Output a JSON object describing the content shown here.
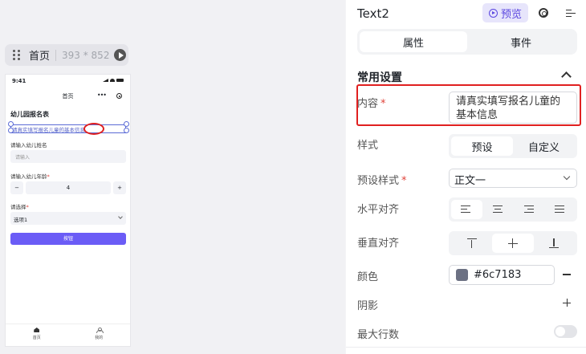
{
  "canvas": {
    "page_pill": {
      "name": "首页",
      "size": "393 * 852"
    },
    "phone": {
      "time": "9:41",
      "nav_title": "首页",
      "nav_more": "•••",
      "form_title": "幼儿园报名表",
      "selected_text": "请真实填写报名儿童的基本信息",
      "field1_label": "请输入幼儿姓名",
      "field1_placeholder": "请输入",
      "field2_label": "请输入幼儿年龄",
      "field2_required": "*",
      "stepper": {
        "minus": "−",
        "value": "4",
        "plus": "+"
      },
      "select_label": "请选择",
      "select_required": "*",
      "select_value": "选项1",
      "button_label": "按钮",
      "tabbar": [
        {
          "label": "首页"
        },
        {
          "label": "我的"
        }
      ]
    }
  },
  "panel": {
    "title": "Text2",
    "preview_label": "预览",
    "tabs": [
      {
        "label": "属性",
        "active": true
      },
      {
        "label": "事件",
        "active": false
      }
    ],
    "section_title": "常用设置",
    "content": {
      "label": "内容",
      "required": "*",
      "value": "请真实填写报名儿童的基本信息"
    },
    "style": {
      "label": "样式",
      "options": [
        "预设",
        "自定义"
      ],
      "active": "预设"
    },
    "preset_style": {
      "label": "预设样式",
      "required": "*",
      "value": "正文一"
    },
    "h_align": {
      "label": "水平对齐",
      "active": "left"
    },
    "v_align": {
      "label": "垂直对齐",
      "active": "middle"
    },
    "color": {
      "label": "颜色",
      "value": "#6c7183",
      "swatch": "#6c7183"
    },
    "shadow": {
      "label": "阴影"
    },
    "max_lines": {
      "label": "最大行数",
      "enabled": false
    }
  },
  "colors": {
    "accent": "#6b5cf6",
    "highlight": "#e02020",
    "selection": "#5b6bd6"
  }
}
